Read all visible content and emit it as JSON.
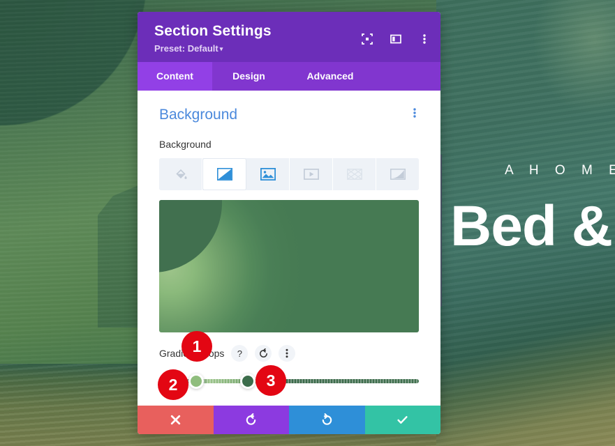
{
  "hero": {
    "eyebrow": "A  H O M E  A",
    "title": "Bed &"
  },
  "panel": {
    "header": {
      "title": "Section Settings",
      "preset_label": "Preset: Default",
      "preset_caret": "▼",
      "icons": [
        {
          "name": "focus-icon",
          "title": "Focus"
        },
        {
          "name": "layout-icon",
          "title": "Layout"
        },
        {
          "name": "more-options-icon",
          "title": "More Options"
        }
      ]
    },
    "tabs": [
      {
        "label": "Content",
        "active": true
      },
      {
        "label": "Design",
        "active": false
      },
      {
        "label": "Advanced",
        "active": false
      }
    ],
    "section": {
      "title": "Background",
      "options_icon": "vertical-dots-icon"
    },
    "field": {
      "label": "Background",
      "types": [
        {
          "name": "background-color-icon",
          "label": "Color",
          "state": "inactive"
        },
        {
          "name": "background-gradient-icon",
          "label": "Gradient",
          "state": "active"
        },
        {
          "name": "background-image-icon",
          "label": "Image",
          "state": "filled"
        },
        {
          "name": "background-video-icon",
          "label": "Video",
          "state": "inactive"
        },
        {
          "name": "background-pattern-icon",
          "label": "Pattern",
          "state": "inactive"
        },
        {
          "name": "background-mask-icon",
          "label": "Mask",
          "state": "inactive"
        }
      ]
    },
    "gradient": {
      "preview_colors": [
        "#9dc48a",
        "#477b53",
        "#41704f"
      ],
      "stops_label": "Gradient Stops",
      "tools": [
        {
          "name": "help-icon",
          "glyph": "?"
        },
        {
          "name": "reset-icon",
          "glyph": "↺"
        },
        {
          "name": "stop-options-icon",
          "glyph": "⋮"
        }
      ],
      "stops": [
        {
          "name": "gradient-stop-handle-1",
          "color": "#8fbd7d",
          "position_pct": 12
        },
        {
          "name": "gradient-stop-handle-2",
          "color": "#3c6d4b",
          "position_pct": 32
        }
      ]
    },
    "footer": [
      {
        "name": "cancel-button",
        "glyph": "✖",
        "color": "#e8605d"
      },
      {
        "name": "undo-button",
        "glyph": "↺",
        "color": "#8c3ae0"
      },
      {
        "name": "redo-button",
        "glyph": "↻",
        "color": "#2e8fd8"
      },
      {
        "name": "save-button",
        "glyph": "✔",
        "color": "#33c3a5"
      }
    ]
  },
  "annotations": [
    {
      "label": "1"
    },
    {
      "label": "2"
    },
    {
      "label": "3"
    }
  ]
}
